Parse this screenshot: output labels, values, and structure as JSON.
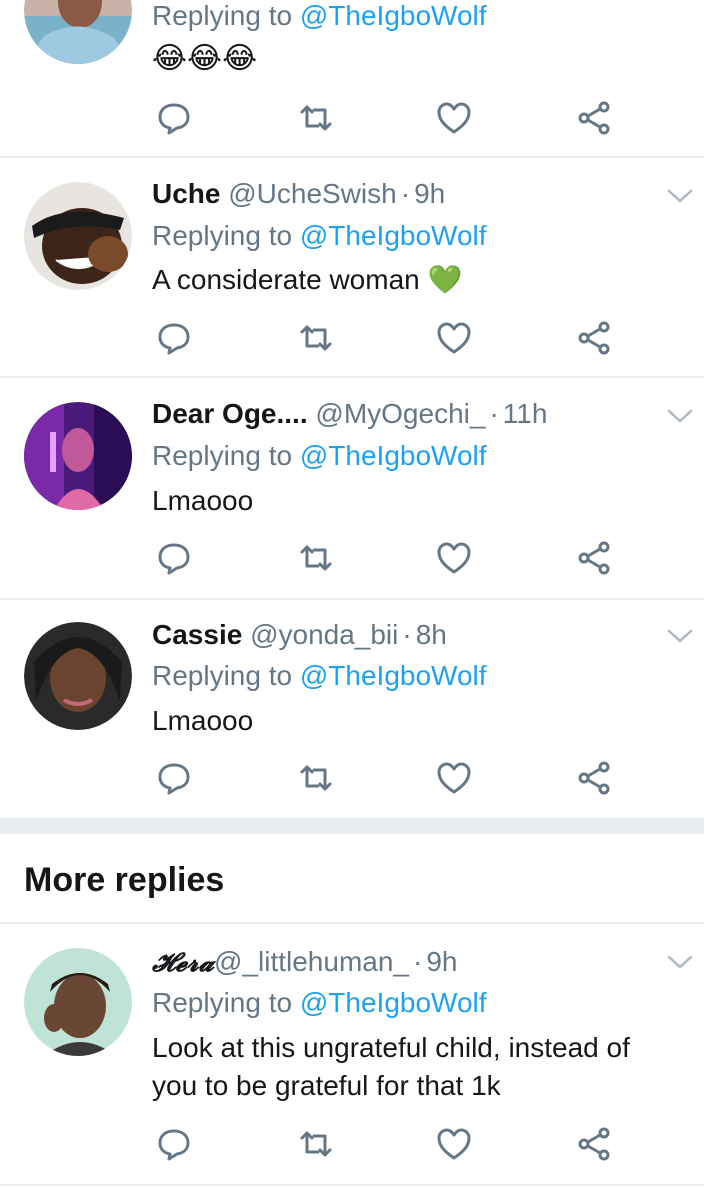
{
  "tweets": [
    {
      "name": "",
      "handle": "",
      "time": "",
      "replying_prefix": "Replying to",
      "replying_handle": "@TheIgboWolf",
      "text": "😂😂😂"
    },
    {
      "name": "Uche",
      "handle": "@UcheSwish",
      "time": "9h",
      "replying_prefix": "Replying to",
      "replying_handle": "@TheIgboWolf",
      "text": "A considerate woman 💚"
    },
    {
      "name": "Dear Oge....",
      "handle": "@MyOgechi_",
      "time": "11h",
      "replying_prefix": "Replying to",
      "replying_handle": "@TheIgboWolf",
      "text": "Lmaooo"
    },
    {
      "name": "Cassie",
      "handle": "@yonda_bii",
      "time": "8h",
      "replying_prefix": "Replying to",
      "replying_handle": "@TheIgboWolf",
      "text": "Lmaooo"
    },
    {
      "name": "𝓗𝓮𝓻𝓪",
      "handle": "@_littlehuman_",
      "time": "9h",
      "replying_prefix": "Replying to",
      "replying_handle": "@TheIgboWolf",
      "text": "Look at this ungrateful child, instead of",
      "text2": "you to be grateful for that 1k"
    }
  ],
  "sections": {
    "more_replies": "More replies"
  },
  "icons": {
    "reply": "reply-icon",
    "retweet": "retweet-icon",
    "like": "like-icon",
    "share": "share-icon",
    "caret": "chevron-down-icon"
  },
  "colors": {
    "link": "#1da1f2",
    "secondary": "#657786",
    "divider": "#e6ecf0"
  }
}
